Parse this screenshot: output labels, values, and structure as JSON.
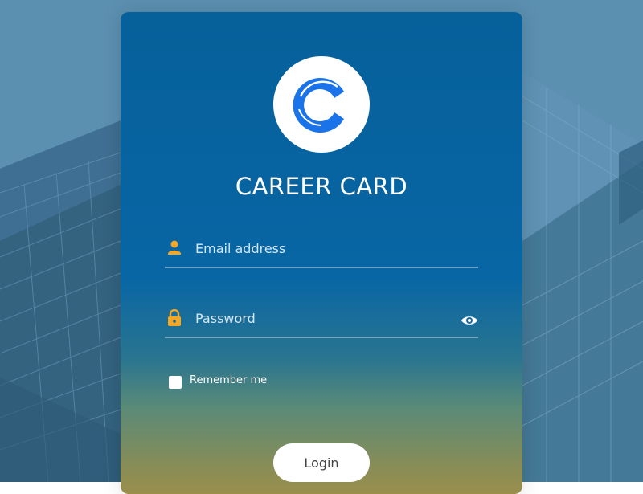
{
  "app": {
    "title": "CAREER CARD",
    "logo_icon": "career-card-c-logo"
  },
  "form": {
    "email": {
      "placeholder": "Email address",
      "value": "",
      "icon": "user-icon"
    },
    "password": {
      "placeholder": "Password",
      "value": "",
      "icon": "lock-icon",
      "toggle_icon": "eye-icon"
    },
    "remember": {
      "label": "Remember me",
      "checked": false
    },
    "login_label": "Login"
  },
  "colors": {
    "accent_icon": "#f5a623",
    "logo_blue": "#1a73e8",
    "card_top": "#06609a",
    "card_bottom": "#9a8e4c"
  }
}
